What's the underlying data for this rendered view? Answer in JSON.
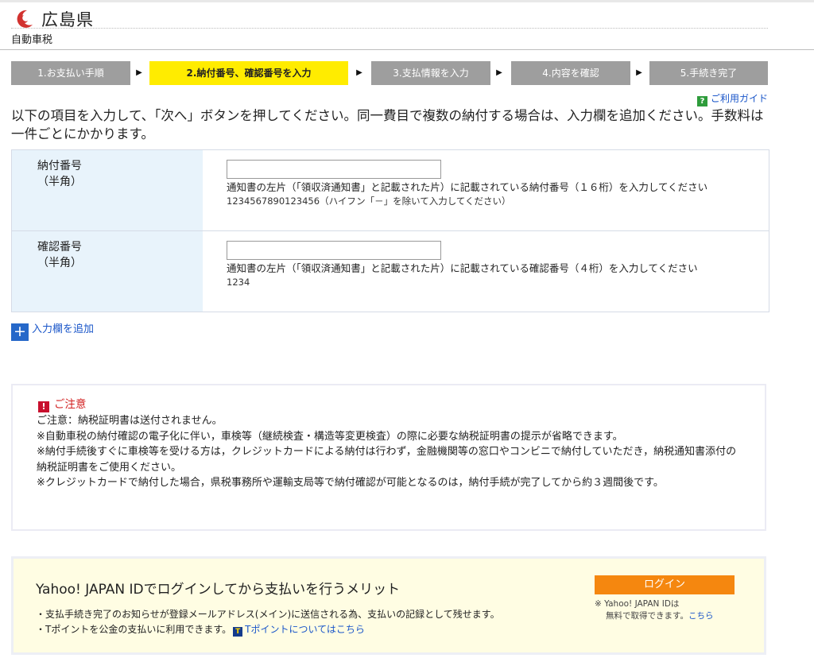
{
  "header": {
    "prefecture": "広島県",
    "tax_type": "自動車税"
  },
  "steps": [
    {
      "label": "1.お支払い手順",
      "active": false
    },
    {
      "label": "2.納付番号、確認番号を入力",
      "active": true
    },
    {
      "label": "3.支払情報を入力",
      "active": false
    },
    {
      "label": "4.内容を確認",
      "active": false
    },
    {
      "label": "5.手続き完了",
      "active": false
    }
  ],
  "guide": {
    "icon": "?",
    "label": "ご利用ガイド"
  },
  "intro": "以下の項目を入力して、「次へ」ボタンを押してください。同一費目で複数の納付する場合は、入力欄を追加ください。手数料は一件ごとにかかります。",
  "form": {
    "payment_number": {
      "label": "納付番号",
      "sub": "（半角）",
      "value": "",
      "hint": "通知書の左片（「領収済通知書」と記載された片）に記載されている納付番号（１６桁）を入力してください",
      "example": "1234567890123456（ハイフン「－」を除いて入力してください）"
    },
    "confirm_number": {
      "label": "確認番号",
      "sub": "（半角）",
      "value": "",
      "hint": "通知書の左片（「領収済通知書」と記載された片）に記載されている確認番号（４桁）を入力してください",
      "example": "1234"
    }
  },
  "add_field": {
    "icon": "+",
    "label": "入力欄を追加"
  },
  "notice": {
    "icon": "!",
    "title": "ご注意",
    "lines": [
      "ご注意：納税証明書は送付されません。",
      "※自動車税の納付確認の電子化に伴い，車検等（継続検査・構造等変更検査）の際に必要な納税証明書の提示が省略できます。",
      "※納付手続後すぐに車検等を受ける方は，クレジットカードによる納付は行わず，金融機関等の窓口やコンビニで納付していただき，納税通知書添付の納税証明書をご使用ください。",
      "※クレジットカードで納付した場合，県税事務所や運輸支局等で納付確認が可能となるのは，納付手続が完了してから約３週間後です。"
    ]
  },
  "yahoo": {
    "title": "Yahoo! JAPAN IDでログインしてから支払いを行うメリット",
    "point1": "・支払手続き完了のお知らせが登録メールアドレス(メイン)に送信される為、支払いの記録として残せます。",
    "point2": "・Tポイントを公金の支払いに利用できます。",
    "tpoint_icon": "T",
    "tpoint_link": "Tポイントについてはこちら",
    "login_button": "ログイン",
    "login_note_1": "※ Yahoo! JAPAN IDは",
    "login_note_2": "無料で取得できます。",
    "login_note_link": "こちら"
  },
  "colors": {
    "active_step": "#ffec00",
    "inactive_step": "#9e9e9e",
    "label_bg": "#e8f3fb",
    "link": "#1a56c9",
    "login_button": "#f5870f",
    "notice_red": "#d21f1f",
    "yahoo_bg": "#fffde3"
  }
}
